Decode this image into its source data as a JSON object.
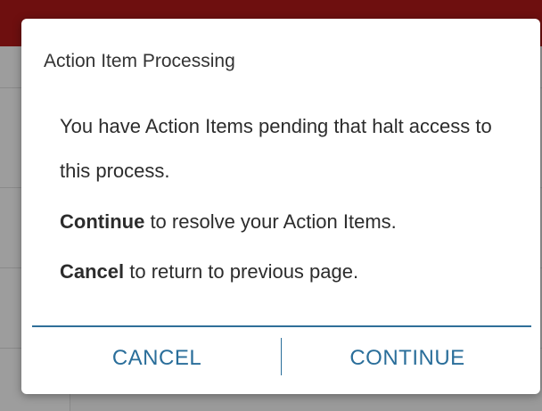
{
  "dialog": {
    "title": "Action Item Processing",
    "message_line": "You have Action Items pending that halt access to this process.",
    "continue_keyword": "Continue",
    "continue_rest": " to resolve your Action Items.",
    "cancel_keyword": "Cancel",
    "cancel_rest": " to return to previous page.",
    "cancel_button": "CANCEL",
    "continue_button": "CONTINUE"
  },
  "colors": {
    "header": "#6e0f0f",
    "button_text": "#2a6e9a",
    "divider": "#2f6f99"
  }
}
